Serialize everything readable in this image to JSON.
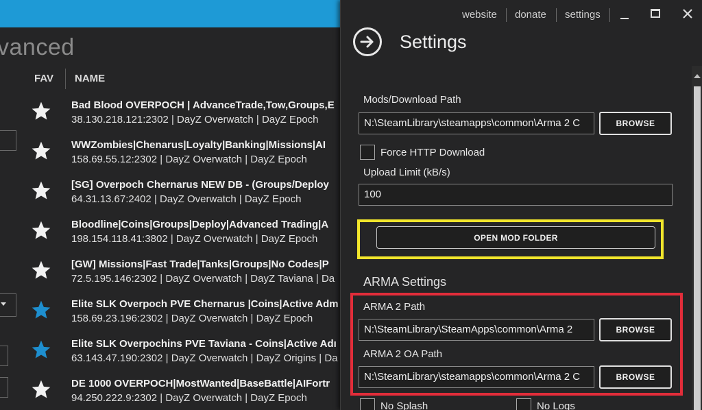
{
  "background": {
    "heading": "vanced",
    "columns": {
      "fav": "FAV",
      "name": "NAME"
    },
    "servers": [
      {
        "name": "Bad Blood OVERPOCH | AdvanceTrade,Tow,Groups,E",
        "info": "38.130.218.121:2302 | DayZ Overwatch | DayZ Epoch",
        "favorite": false
      },
      {
        "name": "WWZombies|Chenarus|Loyalty|Banking|Missions|AI",
        "info": "158.69.55.12:2302 | DayZ Overwatch | DayZ Epoch",
        "favorite": false
      },
      {
        "name": "[SG] Overpoch Chernarus NEW DB - (Groups/Deploy",
        "info": "64.31.13.67:2402 | DayZ Overwatch | DayZ Epoch",
        "favorite": false
      },
      {
        "name": "Bloodline|Coins|Groups|Deploy|Advanced Trading|A",
        "info": "198.154.118.41:3802 | DayZ Overwatch | DayZ Epoch",
        "favorite": false
      },
      {
        "name": "[GW] Missions|Fast Trade|Tanks|Groups|No Codes|P",
        "info": "72.5.195.146:2302 | DayZ Overwatch | DayZ Taviana | Da",
        "favorite": false
      },
      {
        "name": "Elite SLK Overpoch PVE Chernarus |Coins|Active Adm",
        "info": "158.69.23.196:2302 | DayZ Overwatch | DayZ Epoch",
        "favorite": true
      },
      {
        "name": "Elite SLK Overpochins PVE Taviana - Coins|Active Adı",
        "info": "63.143.47.190:2302 | DayZ Overwatch | DayZ Origins | Da",
        "favorite": true
      },
      {
        "name": "DE 1000 OVERPOCH|MostWanted|BaseBattle|AIFortr",
        "info": "94.250.222.9:2302 | DayZ Overwatch | DayZ Epoch",
        "favorite": false
      }
    ]
  },
  "titlebar": {
    "website": "website",
    "donate": "donate",
    "settings": "settings"
  },
  "settings": {
    "title": "Settings",
    "mods_path_label": "Mods/Download Path",
    "mods_path_value": "N:\\SteamLibrary\\steamapps\\common\\Arma 2 C",
    "browse_label": "BROWSE",
    "force_http_label": "Force HTTP Download",
    "upload_limit_label": "Upload Limit (kB/s)",
    "upload_limit_value": "100",
    "open_mod_folder_label": "OPEN MOD FOLDER",
    "arma_section_title": "ARMA Settings",
    "arma2_path_label": "ARMA 2 Path",
    "arma2_path_value": "N:\\SteamLibrary\\SteamApps\\common\\Arma 2",
    "arma2oa_path_label": "ARMA 2 OA Path",
    "arma2oa_path_value": "N:\\SteamLibrary\\steamapps\\common\\Arma 2 C",
    "no_splash_label": "No Splash",
    "no_logs_label": "No Logs"
  },
  "colors": {
    "accent_blue": "#1e9ad6",
    "favorite_star": "#1e8fcf",
    "highlight_yellow": "#f2e62c",
    "highlight_red": "#e22d3a"
  },
  "icons": {
    "back": "arrow-right-circle-icon",
    "minimize": "minimize-icon",
    "maximize": "maximize-icon",
    "close": "close-icon",
    "favorite": "star-icon"
  }
}
